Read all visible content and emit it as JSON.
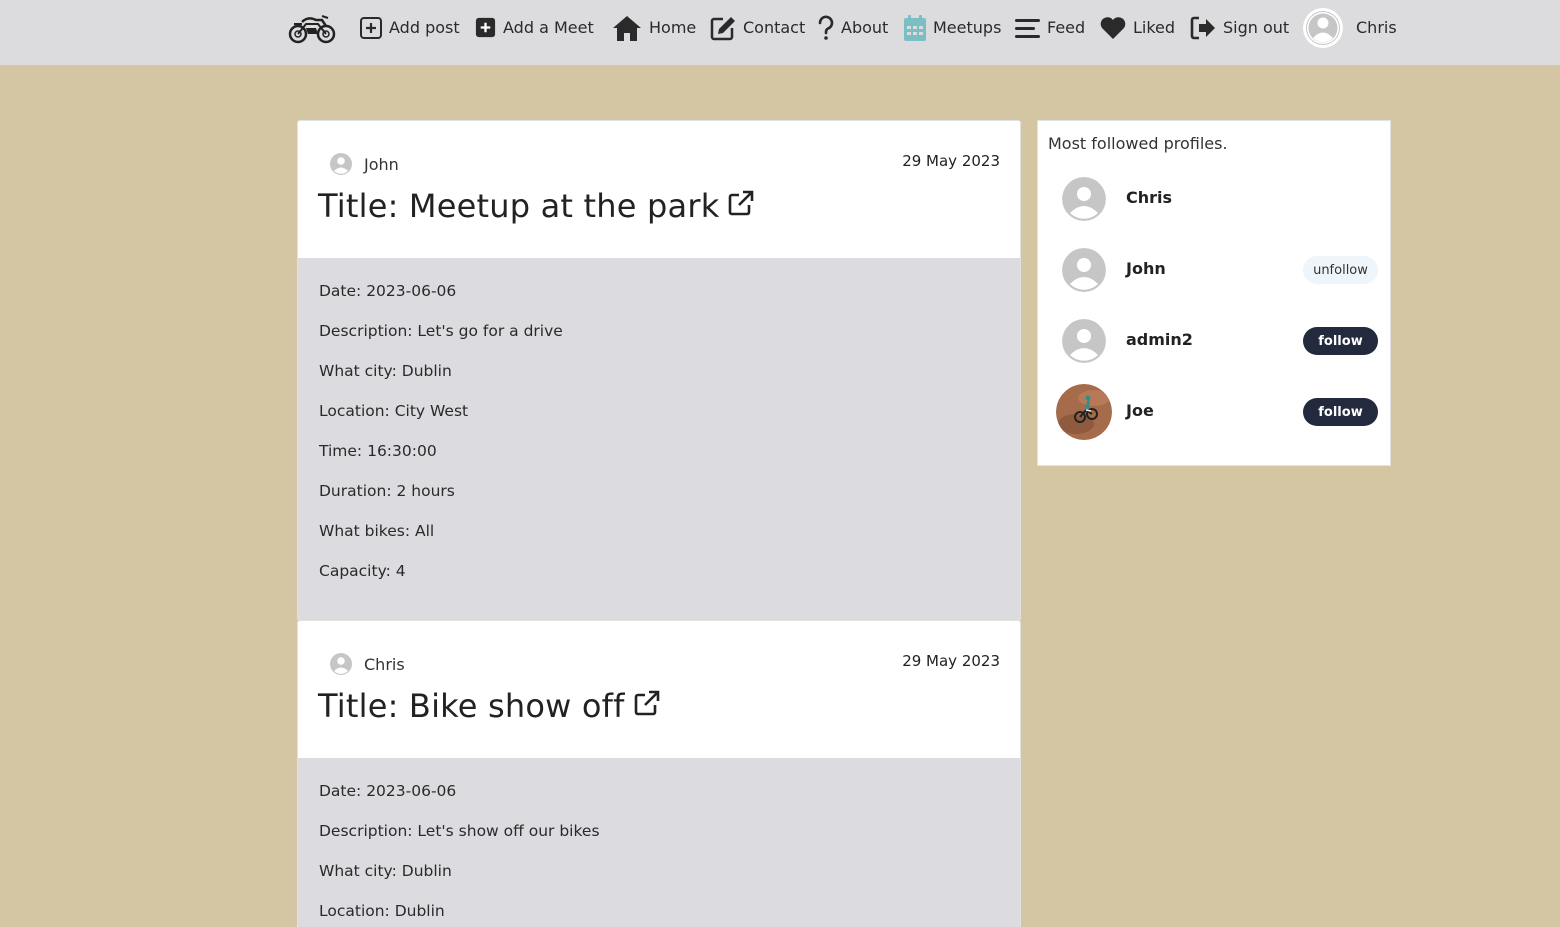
{
  "nav": {
    "items": [
      {
        "label": "Add post",
        "icon": "plus-square-icon"
      },
      {
        "label": "Add a Meet",
        "icon": "plus-square-filled-icon"
      },
      {
        "label": "Home",
        "icon": "home-icon"
      },
      {
        "label": "Contact",
        "icon": "edit-icon"
      },
      {
        "label": "About",
        "icon": "question-icon"
      },
      {
        "label": "Meetups",
        "icon": "calendar-icon"
      },
      {
        "label": "Feed",
        "icon": "stream-icon"
      },
      {
        "label": "Liked",
        "icon": "heart-icon"
      },
      {
        "label": "Sign out",
        "icon": "sign-out-icon"
      }
    ],
    "user_name": "Chris"
  },
  "posts": [
    {
      "author": "John",
      "date": "29 May 2023",
      "title": "Title: Meetup at the park",
      "fields": [
        "Date: 2023-06-06",
        "Description: Let's go for a drive",
        "What city: Dublin",
        "Location: City West",
        "Time: 16:30:00",
        "Duration: 2 hours",
        "What bikes: All",
        "Capacity: 4"
      ]
    },
    {
      "author": "Chris",
      "date": "29 May 2023",
      "title": "Title: Bike show off",
      "fields": [
        "Date: 2023-06-06",
        "Description: Let's show off our bikes",
        "What city: Dublin",
        "Location: Dublin"
      ]
    }
  ],
  "sidebar": {
    "title": "Most followed profiles.",
    "profiles": [
      {
        "name": "Chris",
        "button": ""
      },
      {
        "name": "John",
        "button": "unfollow"
      },
      {
        "name": "admin2",
        "button": "follow"
      },
      {
        "name": "Joe",
        "button": "follow"
      }
    ]
  },
  "colors": {
    "background": "#d4c5a3",
    "navbar": "#dcdbde",
    "card_body": "#dcdbdf",
    "button_dark": "#232a3d",
    "meetups_icon": "#7bbfc4"
  }
}
